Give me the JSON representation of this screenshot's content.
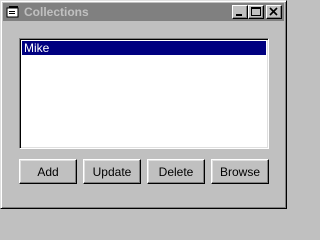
{
  "window": {
    "title": "Collections"
  },
  "listbox": {
    "items": [
      {
        "label": "Mike",
        "selected": true
      }
    ]
  },
  "buttons": {
    "add": "Add",
    "update": "Update",
    "delete": "Delete",
    "browse": "Browse"
  },
  "colors": {
    "titlebar_inactive": "#808080",
    "selection": "#000080",
    "face": "#c0c0c0"
  }
}
